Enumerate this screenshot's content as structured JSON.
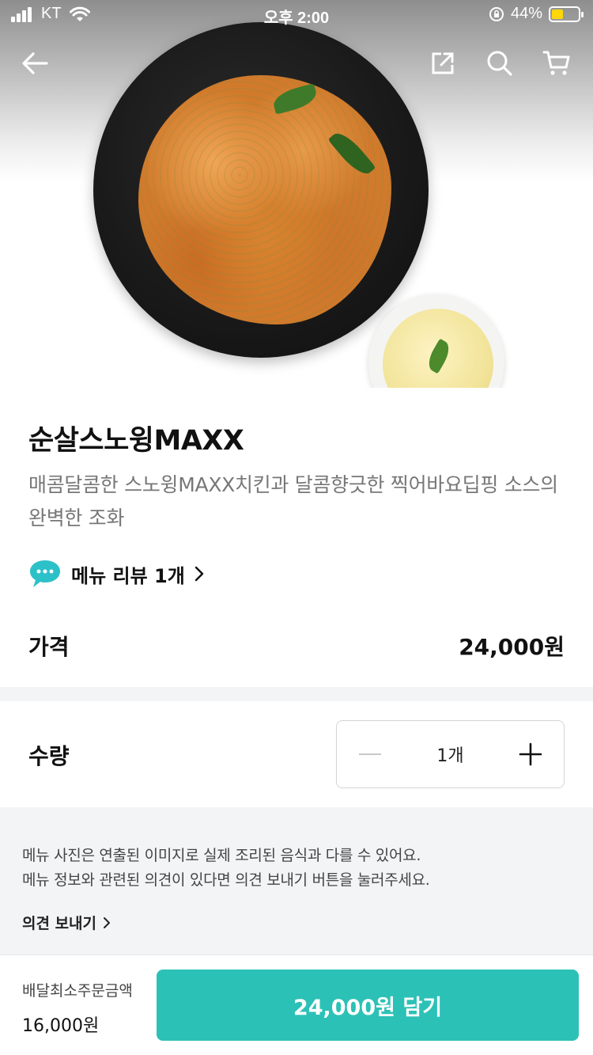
{
  "status_bar": {
    "carrier": "KT",
    "time": "오후 2:00",
    "battery": "44%"
  },
  "header": {
    "icons": [
      "back-arrow-icon",
      "share-icon",
      "search-icon",
      "cart-icon"
    ]
  },
  "product": {
    "name": "순살스노윙MAXX",
    "description": "매콤달콤한 스노윙MAXX치킨과 달콤향긋한 찍어바요딥핑 소스의 완벽한 조화",
    "review_link": "메뉴 리뷰 1개",
    "price_label": "가격",
    "price": "24,000원"
  },
  "quantity": {
    "label": "수량",
    "value": "1개"
  },
  "notice": {
    "line1": "메뉴 사진은 연출된 이미지로 실제 조리된 음식과 다를 수 있어요.",
    "line2": "메뉴 정보와 관련된 의견이 있다면 의견 보내기 버튼을 눌러주세요.",
    "feedback_link": "의견 보내기"
  },
  "bottom_bar": {
    "min_order_label": "배달최소주문금액",
    "min_order_amount": "16,000원",
    "cta_label": "24,000원 담기"
  },
  "colors": {
    "accent": "#2cc1b6",
    "review_bubble": "#2cc1c9",
    "battery_fill": "#ffd60a"
  }
}
